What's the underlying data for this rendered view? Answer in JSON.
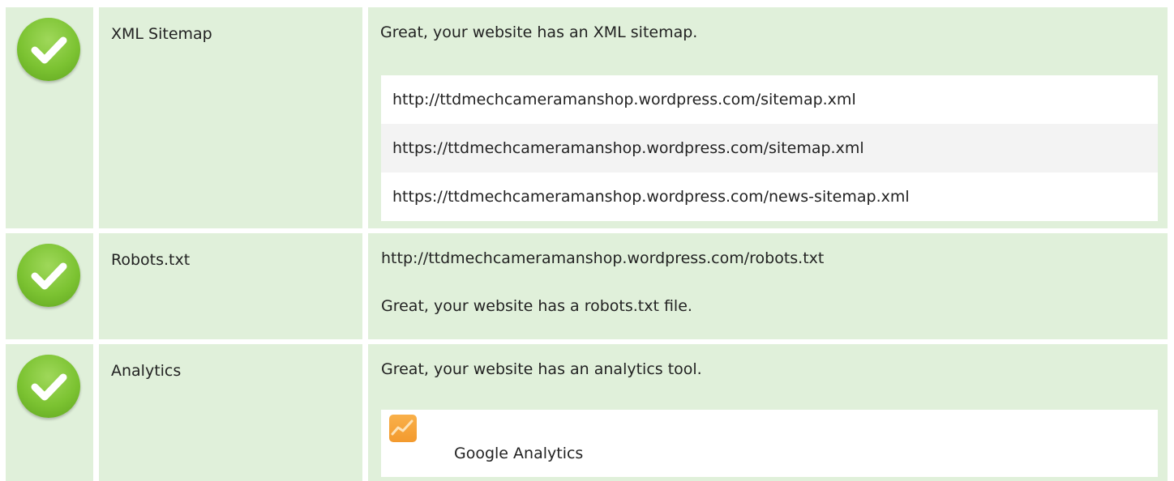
{
  "colors": {
    "row_bg": "#e0f0da",
    "check": "#7cc332",
    "ga_orange": "#f39a2e"
  },
  "rows": [
    {
      "icon": "check-circle-icon",
      "label": "XML Sitemap",
      "message": "Great, your website has an XML sitemap.",
      "sitemaps": [
        "http://ttdmechcameramanshop.wordpress.com/sitemap.xml",
        "https://ttdmechcameramanshop.wordpress.com/sitemap.xml",
        "https://ttdmechcameramanshop.wordpress.com/news-sitemap.xml"
      ]
    },
    {
      "icon": "check-circle-icon",
      "label": "Robots.txt",
      "url": "http://ttdmechcameramanshop.wordpress.com/robots.txt",
      "message": "Great, your website has a robots.txt file."
    },
    {
      "icon": "check-circle-icon",
      "label": "Analytics",
      "message": "Great, your website has an analytics tool.",
      "tool": {
        "icon": "google-analytics-icon",
        "name": "Google Analytics"
      }
    }
  ]
}
